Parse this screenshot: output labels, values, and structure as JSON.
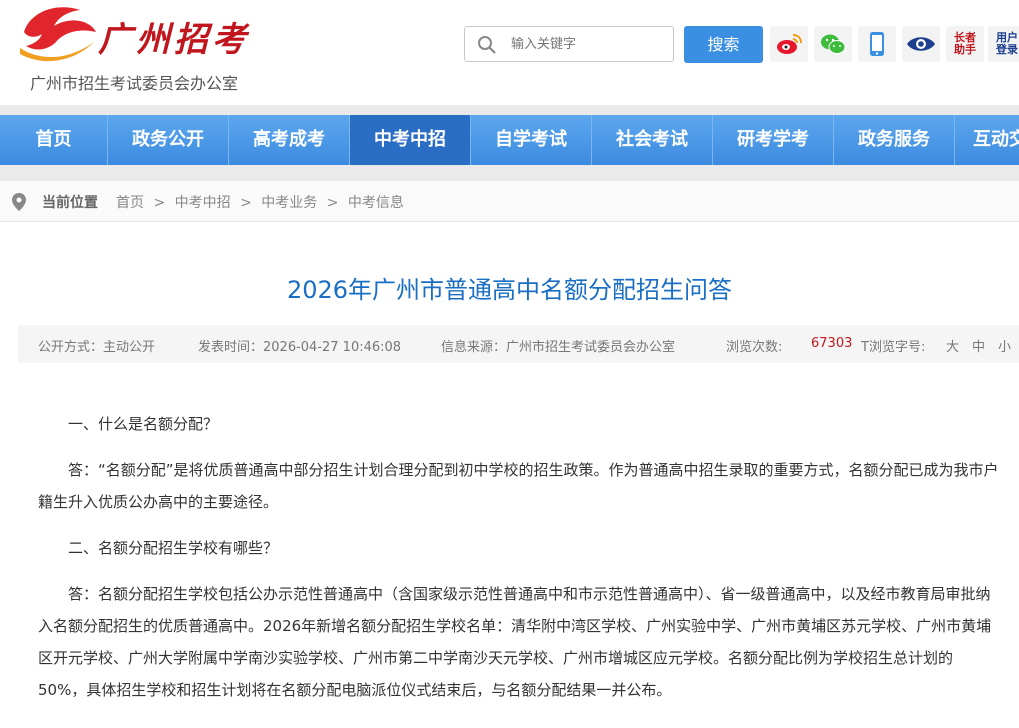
{
  "header": {
    "logo_title": "广州招考",
    "logo_subtitle": "广州市招生考试委员会办公室",
    "search_placeholder": "输入关键字",
    "search_button": "搜索",
    "tools": {
      "elder_label": "长者助手",
      "login_label": "用户登录"
    }
  },
  "nav": {
    "items": [
      {
        "label": "首页"
      },
      {
        "label": "政务公开"
      },
      {
        "label": "高考成考"
      },
      {
        "label": "中考中招",
        "active": true
      },
      {
        "label": "自学考试"
      },
      {
        "label": "社会考试"
      },
      {
        "label": "研考学考"
      },
      {
        "label": "政务服务"
      },
      {
        "label": "互动交"
      }
    ]
  },
  "breadcrumb": {
    "label": "当前位置",
    "items": [
      "首页",
      ">",
      "中考中招",
      ">",
      "中考业务",
      ">",
      "中考信息"
    ]
  },
  "article": {
    "title": "2026年广州市普通高中名额分配招生问答",
    "meta": {
      "open_mode": "公开方式：主动公开",
      "publish_time": "发表时间：2026-04-27 10:46:08",
      "source": "信息来源：广州市招生考试委员会办公室",
      "views_label": "浏览次数:",
      "views": "67303",
      "font_label": "T浏览字号:",
      "font_large": "大",
      "font_medium": "中",
      "font_small": "小"
    },
    "q1": "一、什么是名额分配？",
    "a1": "答：“名额分配”是将优质普通高中部分招生计划合理分配到初中学校的招生政策。作为普通高中招生录取的重要方式，名额分配已成为我市户籍生升入优质公办高中的主要途径。",
    "q2": "二、名额分配招生学校有哪些？",
    "a2": "答：名额分配招生学校包括公办示范性普通高中（含国家级示范性普通高中和市示范性普通高中）、省一级普通高中，以及经市教育局审批纳入名额分配招生的优质普通高中。2026年新增名额分配招生学校名单：清华附中湾区学校、广州实验中学、广州市黄埔区苏元学校、广州市黄埔区开元学校、广州大学附属中学南沙实验学校、广州市第二中学南沙天元学校、广州市增城区应元学校。名额分配比例为学校招生总计划的50%，具体招生学校和招生计划将在名额分配电脑派位仪式结束后，与名额分配结果一并公布。"
  },
  "colors": {
    "brand_red": "#c0161d",
    "nav_blue": "#3d8be0",
    "title_blue": "#1a6fc4"
  }
}
